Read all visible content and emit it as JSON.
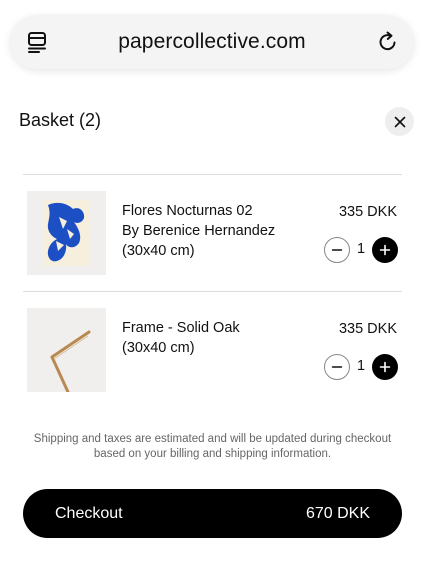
{
  "browser": {
    "url": "papercollective.com",
    "left_icon": "tabs-icon",
    "right_icon": "reload-icon"
  },
  "basket": {
    "title": "Basket (2)",
    "close_icon": "close-icon"
  },
  "items": [
    {
      "name": "Flores Nocturnas 02",
      "artist": "By Berenice Hernandez",
      "size": "(30x40 cm)",
      "price": "335 DKK",
      "quantity": "1",
      "thumbnail": "blue-abstract-print"
    },
    {
      "name": "Frame - Solid Oak",
      "size": "(30x40 cm)",
      "price": "335 DKK",
      "quantity": "1",
      "thumbnail": "oak-frame-corner"
    }
  ],
  "note": "Shipping and taxes are estimated and will be updated during checkout based on your billing and shipping information.",
  "checkout": {
    "label": "Checkout",
    "total": "670 DKK"
  },
  "colors": {
    "accent": "#000000",
    "print_blue": "#1d4fc4",
    "oak": "#b88a52"
  }
}
